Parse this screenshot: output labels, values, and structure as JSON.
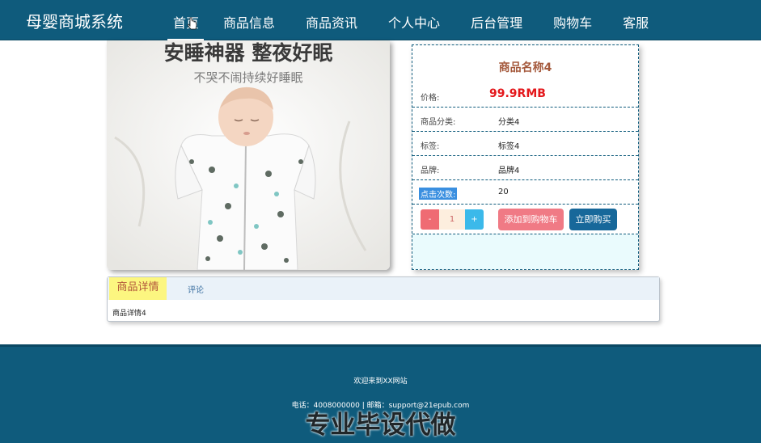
{
  "header": {
    "brand": "母婴商城系统",
    "nav": [
      "首页",
      "商品信息",
      "商品资讯",
      "个人中心",
      "后台管理",
      "购物车",
      "客服"
    ]
  },
  "product_image": {
    "headline": "安睡神器 整夜好眠",
    "subline": "不哭不闹持续好睡眠"
  },
  "product": {
    "name": "商品名称4",
    "price_label": "价格:",
    "price": "99.9RMB",
    "category_label": "商品分类:",
    "category": "分类4",
    "tag_label": "标签:",
    "tag": "标签4",
    "brand_label": "品牌:",
    "brand": "品牌4",
    "clicks_label": "点击次数:",
    "clicks": "20",
    "quantity": "1",
    "minus": "-",
    "plus": "+",
    "add_cart": "添加到购物车",
    "buy_now": "立即购买"
  },
  "detail": {
    "tabs": [
      "商品详情",
      "评论"
    ],
    "content": "商品详情4"
  },
  "footer": {
    "welcome": "欢迎来到XX网站",
    "contact": "电话：4008000000 | 邮箱：support@21epub.com",
    "watermark": "专业毕设代做"
  },
  "colors": {
    "header_bg": "#0f5b7c",
    "price": "#e4181c",
    "product_name": "#a55a3d",
    "add_cart_button": "#f07a85",
    "buy_button": "#17689a",
    "active_tab": "#fcf680"
  }
}
